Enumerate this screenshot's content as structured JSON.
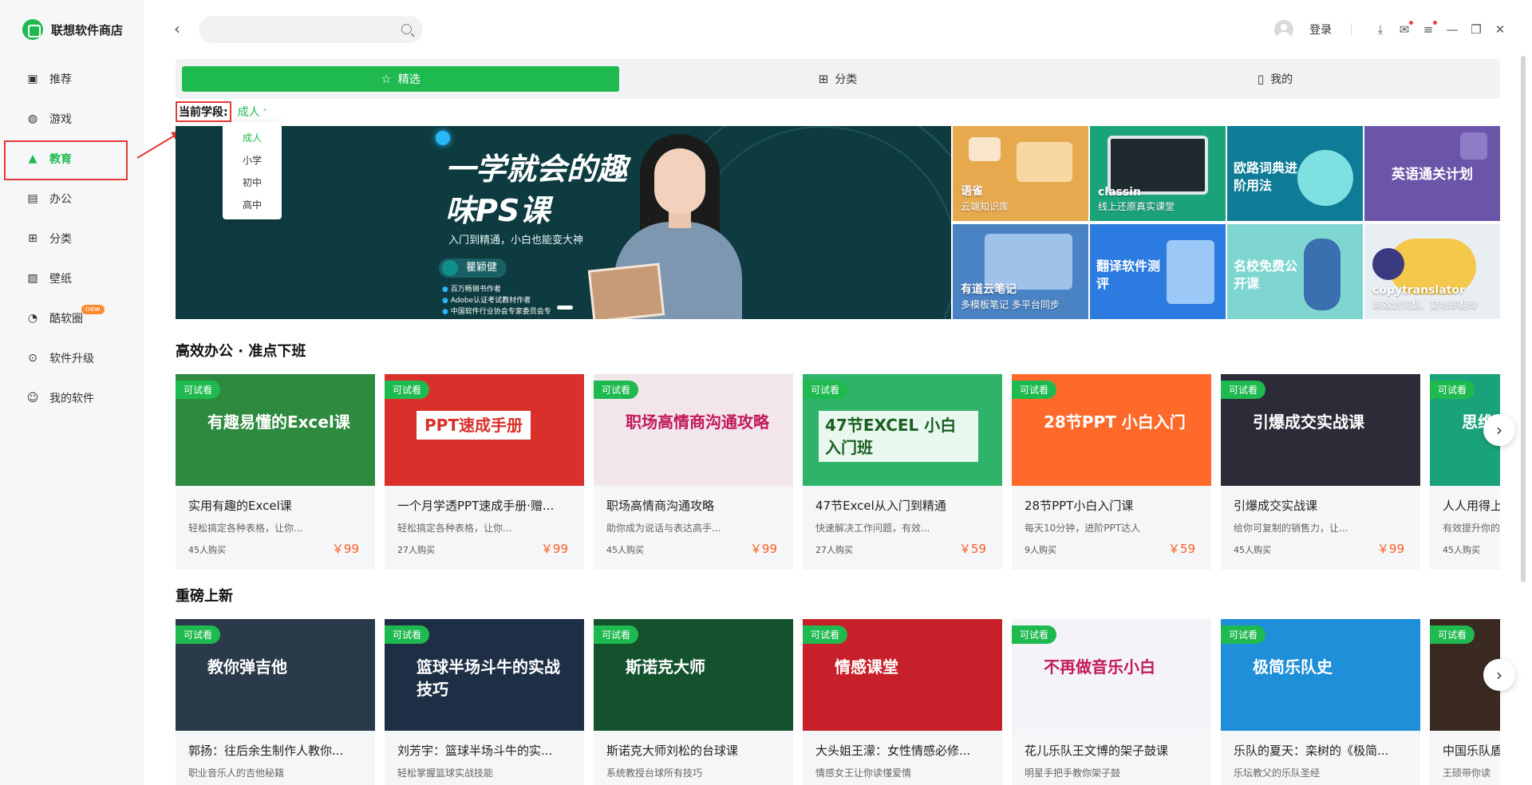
{
  "app": {
    "name": "联想软件商店"
  },
  "sidebar": {
    "items": [
      {
        "label": "推荐",
        "icon": "recommend-icon"
      },
      {
        "label": "游戏",
        "icon": "gamepad-icon"
      },
      {
        "label": "教育",
        "icon": "graduation-cap-icon"
      },
      {
        "label": "办公",
        "icon": "briefcase-icon"
      },
      {
        "label": "分类",
        "icon": "grid-icon"
      },
      {
        "label": "壁纸",
        "icon": "image-icon"
      },
      {
        "label": "酷软圈",
        "icon": "circle-icon",
        "badge": "new"
      },
      {
        "label": "软件升级",
        "icon": "upgrade-icon"
      },
      {
        "label": "我的软件",
        "icon": "my-software-icon"
      }
    ],
    "active_index": 2
  },
  "topbar": {
    "search_placeholder": "",
    "login": "登录"
  },
  "tabs": [
    {
      "label": "精选",
      "icon": "star-icon"
    },
    {
      "label": "分类",
      "icon": "grid-icon"
    },
    {
      "label": "我的",
      "icon": "bookmark-icon"
    }
  ],
  "stage": {
    "label": "当前学段:",
    "value": "成人",
    "options": [
      "成人",
      "小学",
      "初中",
      "高中"
    ]
  },
  "banner": {
    "title": "一学就会的趣味PS课",
    "subtitle": "入门到精通，小白也能变大神",
    "teacher": "瞿颖健",
    "bullets": [
      "百万畅销书作者",
      "Adobe认证考试教材作者",
      "中国软件行业协会专家委员会专"
    ]
  },
  "tiles": [
    {
      "title": "语雀",
      "sub": "云端知识库",
      "color": "#e7a94e"
    },
    {
      "title": "classin",
      "sub": "线上还原真实课堂",
      "color": "#1aa37a"
    },
    {
      "title": "欧路词典进阶用法",
      "sub": "",
      "color": "#0e7c96"
    },
    {
      "title": "英语通关计划",
      "sub": "",
      "color": "#6a55a8"
    },
    {
      "title": "有道云笔记",
      "sub": "多模板笔记 多平台同步",
      "color": "#4a83c4"
    },
    {
      "title": "翻译软件测评",
      "sub": "",
      "color": "#2b7be0"
    },
    {
      "title": "名校免费公开课",
      "sub": "",
      "color": "#7fd6d0"
    },
    {
      "title": "copytranslator",
      "sub": "高效划词翻、复制即翻译",
      "color": "#e9eef2"
    }
  ],
  "sections": [
    {
      "title": "高效办公 · 准点下班",
      "cards": [
        {
          "badge": "可试看",
          "title": "实用有趣的Excel课",
          "desc": "轻松搞定各种表格，让你...",
          "buyers": "45人购买",
          "price": "￥99",
          "thumb_text": "有趣易懂的Excel课",
          "bg": "#2d8a3e"
        },
        {
          "badge": "可试看",
          "title": "一个月学透PPT速成手册·赠...",
          "desc": "轻松搞定各种表格，让你...",
          "buyers": "27人购买",
          "price": "￥99",
          "thumb_text": "PPT速成手册",
          "bg": "#d9302b"
        },
        {
          "badge": "可试看",
          "title": "职场高情商沟通攻略",
          "desc": "助你成为说话与表达高手...",
          "buyers": "45人购买",
          "price": "￥99",
          "thumb_text": "职场高情商沟通攻略",
          "bg": "#f2e6ea"
        },
        {
          "badge": "可试看",
          "title": "47节Excel从入门到精通",
          "desc": "快速解决工作问题，有效...",
          "buyers": "27人购买",
          "price": "￥59",
          "thumb_text": "47节EXCEL 小白入门班",
          "bg": "#2fb36a"
        },
        {
          "badge": "可试看",
          "title": "28节PPT小白入门课",
          "desc": "每天10分钟，进阶PPT达人",
          "buyers": "9人购买",
          "price": "￥59",
          "thumb_text": "28节PPT 小白入门",
          "bg": "#ff6a2a"
        },
        {
          "badge": "可试看",
          "title": "引爆成交实战课",
          "desc": "给你可复制的销售力，让...",
          "buyers": "45人购买",
          "price": "￥99",
          "thumb_text": "引爆成交实战课",
          "bg": "#2c2c38"
        },
        {
          "badge": "可试看",
          "title": "人人用得上",
          "desc": "有效提升你的",
          "buyers": "45人购买",
          "price": "",
          "thumb_text": "思维",
          "bg": "#1aa37a"
        }
      ]
    },
    {
      "title": "重磅上新",
      "cards": [
        {
          "badge": "可试看",
          "title": "郭扬：往后余生制作人教你...",
          "desc": "职业音乐人的吉他秘籍",
          "thumb_text": "教你弹吉他",
          "bg": "#2a3a4a"
        },
        {
          "badge": "可试看",
          "title": "刘芳宇：篮球半场斗牛的实...",
          "desc": "轻松掌握篮球实战技能",
          "thumb_text": "篮球半场斗牛的实战技巧",
          "bg": "#1e2f45"
        },
        {
          "badge": "可试看",
          "title": "斯诺克大师刘松的台球课",
          "desc": "系统教授台球所有技巧",
          "thumb_text": "斯诺克大师",
          "bg": "#14522e"
        },
        {
          "badge": "可试看",
          "title": "大头姐王濛：女性情感必修...",
          "desc": "情感女王让你读懂爱情",
          "thumb_text": "情感课堂",
          "bg": "#c8202a"
        },
        {
          "badge": "可试看",
          "title": "花儿乐队王文博的架子鼓课",
          "desc": "明星手把手教你架子鼓",
          "thumb_text": "不再做音乐小白",
          "bg": "#f4f4f8"
        },
        {
          "badge": "可试看",
          "title": "乐队的夏天：栾树的《极简...",
          "desc": "乐坛教父的乐队圣经",
          "thumb_text": "极简乐队史",
          "bg": "#1e8fd8"
        },
        {
          "badge": "可试看",
          "title": "中国乐队盾",
          "desc": "王硕带你读",
          "thumb_text": "",
          "bg": "#3a2a22"
        }
      ]
    }
  ]
}
